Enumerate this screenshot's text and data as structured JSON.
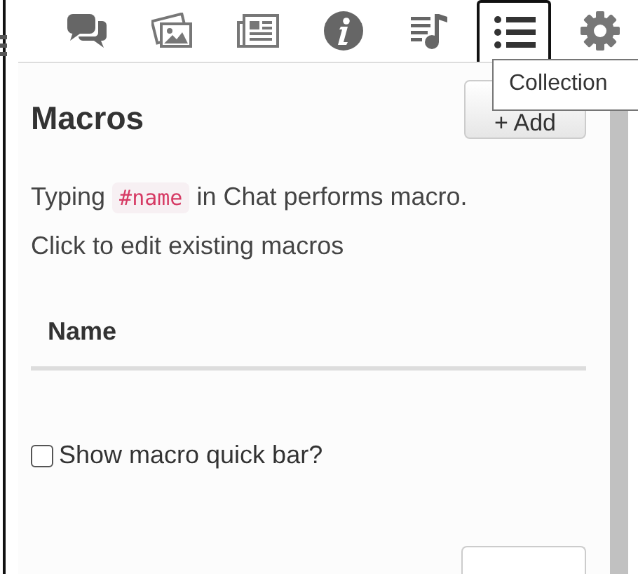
{
  "tabs": [
    {
      "kind": "chat",
      "selected": false
    },
    {
      "kind": "pictures",
      "selected": false
    },
    {
      "kind": "news",
      "selected": false
    },
    {
      "kind": "info",
      "selected": false
    },
    {
      "kind": "music",
      "selected": false
    },
    {
      "kind": "list",
      "selected": true
    },
    {
      "kind": "gear",
      "selected": false
    }
  ],
  "tooltip": "Collection",
  "panel": {
    "title": "Macros",
    "add_button": "+ Add",
    "intro": {
      "before": "Typing",
      "code": "#name",
      "after": "in Chat performs macro."
    },
    "hint": "Click to edit existing macros",
    "table": {
      "columns": [
        "Name"
      ]
    },
    "quick_bar": {
      "label": "Show macro quick bar?",
      "checked": false
    }
  }
}
